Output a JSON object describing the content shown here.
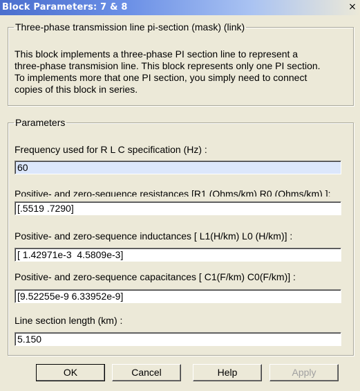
{
  "window": {
    "title": "Block Parameters: 7 & 8",
    "close_glyph": "×"
  },
  "description": {
    "legend": "Three-phase transmission line pi-section (mask) (link)",
    "text": "This block implements a three-phase PI section line to represent a\nthree-phase transmision line. This block represents only  one PI section.\nTo implements more that one PI section,  you  simply need to connect\ncopies of this block in series."
  },
  "parameters": {
    "legend": "Parameters",
    "fields": [
      {
        "label": "Frequency used for R L C specification (Hz) :",
        "value": "60"
      },
      {
        "label": "Positive- and zero-sequence resistances  [R1 (Ohms/km)  R0 (Ohms/km) ]:",
        "value": "[.5519 .7290]"
      },
      {
        "label": "Positive- and zero-sequence inductances [ L1(H/km)  L0 (H/km)] :",
        "value": "[ 1.42971e-3  4.5809e-3]"
      },
      {
        "label": "Positive- and zero-sequence capacitances [ C1(F/km) C0(F/km)] :",
        "value": "[9.52255e-9 6.33952e-9]"
      },
      {
        "label": "Line section length (km) :",
        "value": "5.150"
      }
    ]
  },
  "buttons": {
    "ok": "OK",
    "cancel": "Cancel",
    "help": "Help",
    "apply": "Apply"
  }
}
